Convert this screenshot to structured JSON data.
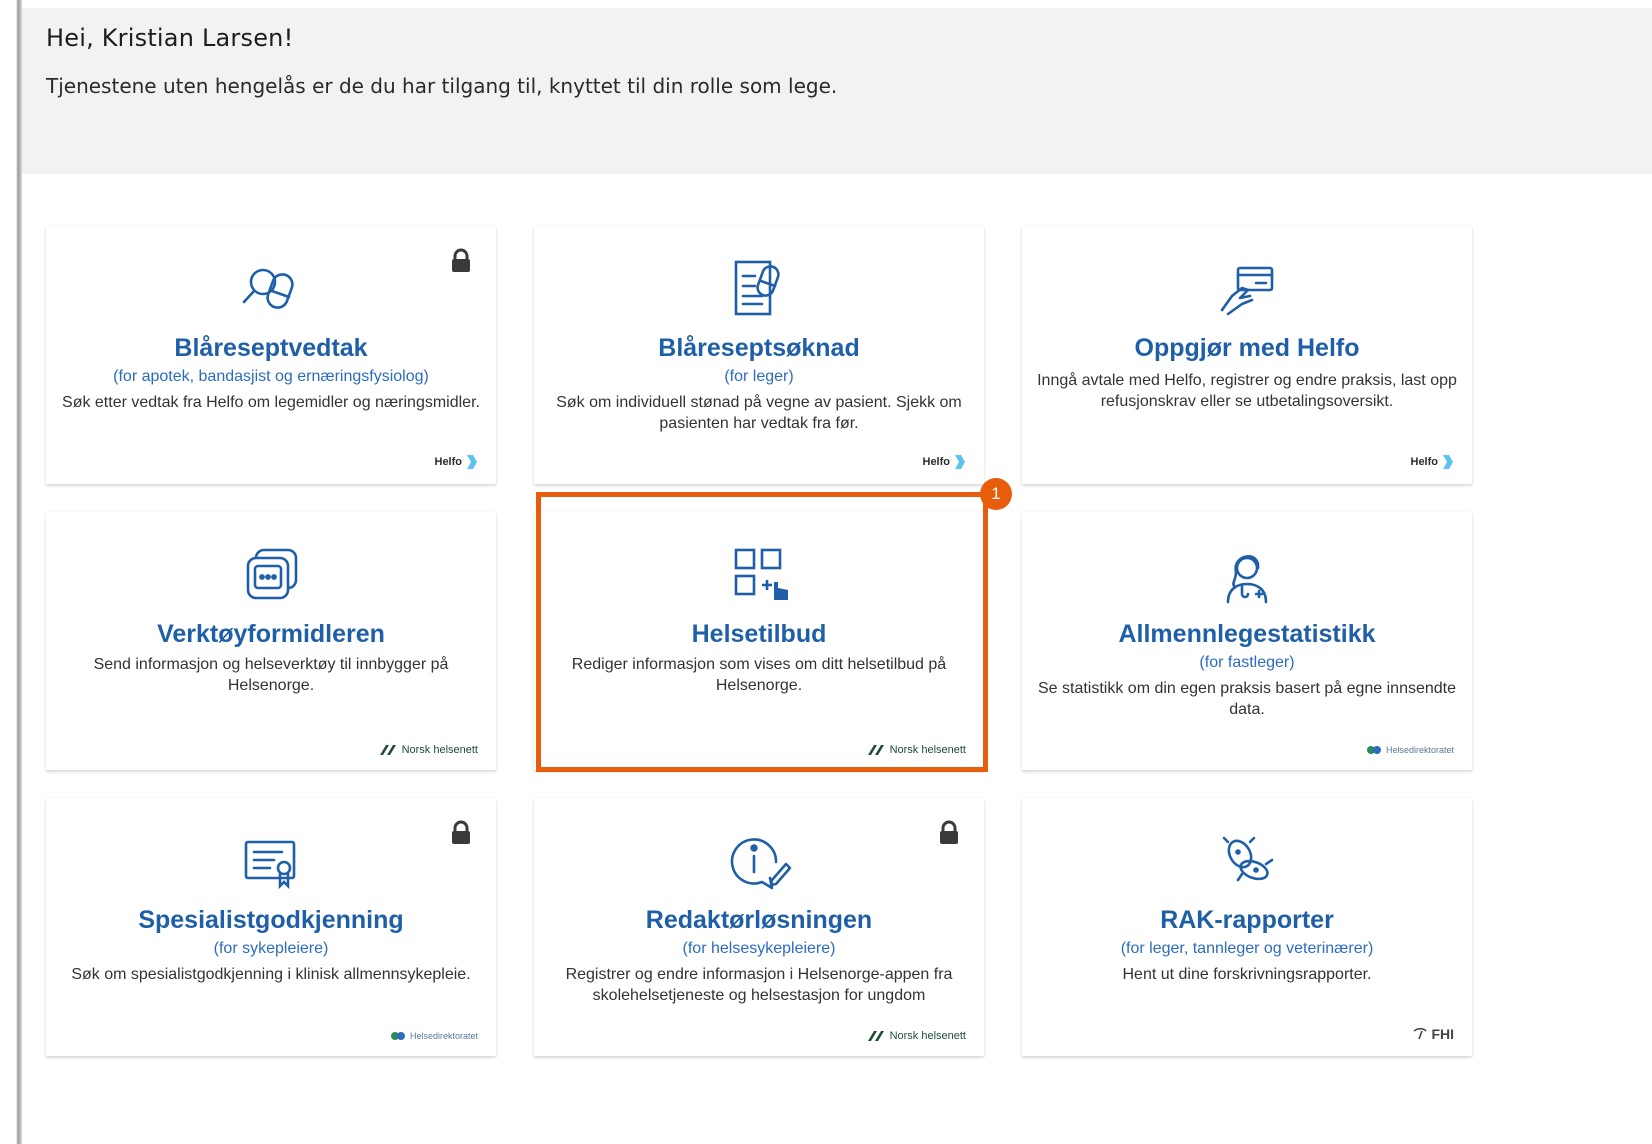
{
  "header": {
    "greeting": "Hei, Kristian Larsen!",
    "intro": "Tjenestene uten hengelås er de du har tilgang til, knyttet til din rolle som lege."
  },
  "cards": [
    {
      "title": "Blåreseptvedtak",
      "subtitle": "(for apotek, bandasjist og ernæringsfysiolog)",
      "description": "Søk etter vedtak fra Helfo om legemidler og næringsmidler.",
      "locked": true,
      "provider": "Helfo",
      "icon": "pill-search-icon"
    },
    {
      "title": "Blåreseptsøknad",
      "subtitle": "(for leger)",
      "description": "Søk om individuell stønad på vegne av pasient. Sjekk om pasienten har vedtak fra før.",
      "locked": false,
      "provider": "Helfo",
      "icon": "prescription-document-icon"
    },
    {
      "title": "Oppgjør med Helfo",
      "subtitle": "",
      "description": "Inngå avtale med Helfo, registrer og endre praksis, last opp refusjonskrav eller se utbetalingsoversikt.",
      "locked": false,
      "provider": "Helfo",
      "icon": "payment-card-hand-icon"
    },
    {
      "title": "Verktøyformidleren",
      "subtitle": "",
      "description": "Send informasjon og helseverktøy til innbygger på Helsenorge.",
      "locked": false,
      "provider": "Norsk helsenett",
      "icon": "message-stack-icon"
    },
    {
      "title": "Helsetilbud",
      "subtitle": "",
      "description": "Rediger informasjon som vises om ditt helsetilbud på Helsenorge.",
      "locked": false,
      "provider": "Norsk helsenett",
      "icon": "grid-add-pointer-icon"
    },
    {
      "title": "Allmennlegestatistikk",
      "subtitle": "(for fastleger)",
      "description": "Se statistikk om din egen praksis basert på egne innsendte data.",
      "locked": false,
      "provider": "Helsedirektoratet",
      "icon": "doctor-icon"
    },
    {
      "title": "Spesialistgodkjenning",
      "subtitle": "(for sykepleiere)",
      "description": "Søk om spesialistgodkjenning i klinisk allmennsykepleie.",
      "locked": true,
      "provider": "Helsedirektoratet",
      "icon": "certificate-icon"
    },
    {
      "title": "Redaktørløsningen",
      "subtitle": "(for helsesykepleiere)",
      "description": "Registrer og endre informasjon i Helsenorge-appen fra skolehelsetjeneste og helsestasjon for ungdom",
      "locked": true,
      "provider": "Norsk helsenett",
      "icon": "info-edit-icon"
    },
    {
      "title": "RAK-rapporter",
      "subtitle": "(for leger, tannleger og veterinærer)",
      "description": "Hent ut dine forskrivningsrapporter.",
      "locked": false,
      "provider": "FHI",
      "icon": "bacteria-icon"
    }
  ],
  "annotation": {
    "badge": "1",
    "color": "#e85d0c"
  },
  "colors": {
    "title": "#1f5fa8",
    "subtitle": "#2c6cc0",
    "header_bg": "#f2f2f2"
  }
}
